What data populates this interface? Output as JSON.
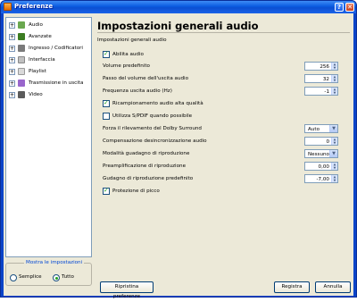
{
  "window": {
    "title": "Preferenze",
    "help_glyph": "?",
    "close_glyph": "✕"
  },
  "sidebar": {
    "items": [
      {
        "label": "Audio",
        "expander": "+",
        "icon": "music-note-icon",
        "color": "#6aa84f"
      },
      {
        "label": "Avanzate",
        "expander": "+",
        "icon": "advanced-settings-icon",
        "color": "#3c7d22"
      },
      {
        "label": "Ingresso / Codificatori",
        "expander": "+",
        "icon": "input-codec-icon",
        "color": "#7a7a7a"
      },
      {
        "label": "Interfaccia",
        "expander": "+",
        "icon": "interface-icon",
        "color": "#c0c0c0"
      },
      {
        "label": "Playlist",
        "expander": "+",
        "icon": "playlist-icon",
        "color": "#d9d9d9"
      },
      {
        "label": "Trasmissione in uscita",
        "expander": "+",
        "icon": "stream-output-icon",
        "color": "#9966cc"
      },
      {
        "label": "Video",
        "expander": "+",
        "icon": "video-icon",
        "color": "#5b5b5b"
      }
    ],
    "show_settings": {
      "title": "Mostra le impostazioni",
      "options": [
        "Semplice",
        "Tutto"
      ],
      "selected": "Tutto"
    }
  },
  "panel": {
    "title": "Impostazioni generali audio",
    "section_title": "Impostazioni generali audio",
    "enable_audio": {
      "label": "Abilita audio",
      "checked": true
    },
    "default_volume": {
      "label": "Volume predefinito",
      "value": "256"
    },
    "volume_step": {
      "label": "Passo del volume dell'uscita audio",
      "value": "32"
    },
    "output_frequency": {
      "label": "Frequenza uscita audio (Hz)",
      "value": "-1"
    },
    "hq_resampling": {
      "label": "Ricampionamento audio alta qualità",
      "checked": true
    },
    "spdif": {
      "label": "Utilizza S/PDIF quando possibile",
      "checked": false
    },
    "dolby": {
      "label": "Forza il rilevamento del Dolby Surround",
      "value": "Auto"
    },
    "desync": {
      "label": "Compensazione desincronizzazione audio",
      "value": "0"
    },
    "replay_gain_mode": {
      "label": "Modalità guadagno di riproduzione",
      "value": "Nessuno"
    },
    "replay_preamp": {
      "label": "Preamplificazione di riproduzione",
      "value": "0,00"
    },
    "replay_default": {
      "label": "Gudagno di riproduzione predefinito",
      "value": "-7,00"
    },
    "peak_protection": {
      "label": "Protezione di picco",
      "checked": true
    }
  },
  "buttons": {
    "reset": "Ripristina preferenze",
    "save": "Registra",
    "cancel": "Annulla"
  }
}
